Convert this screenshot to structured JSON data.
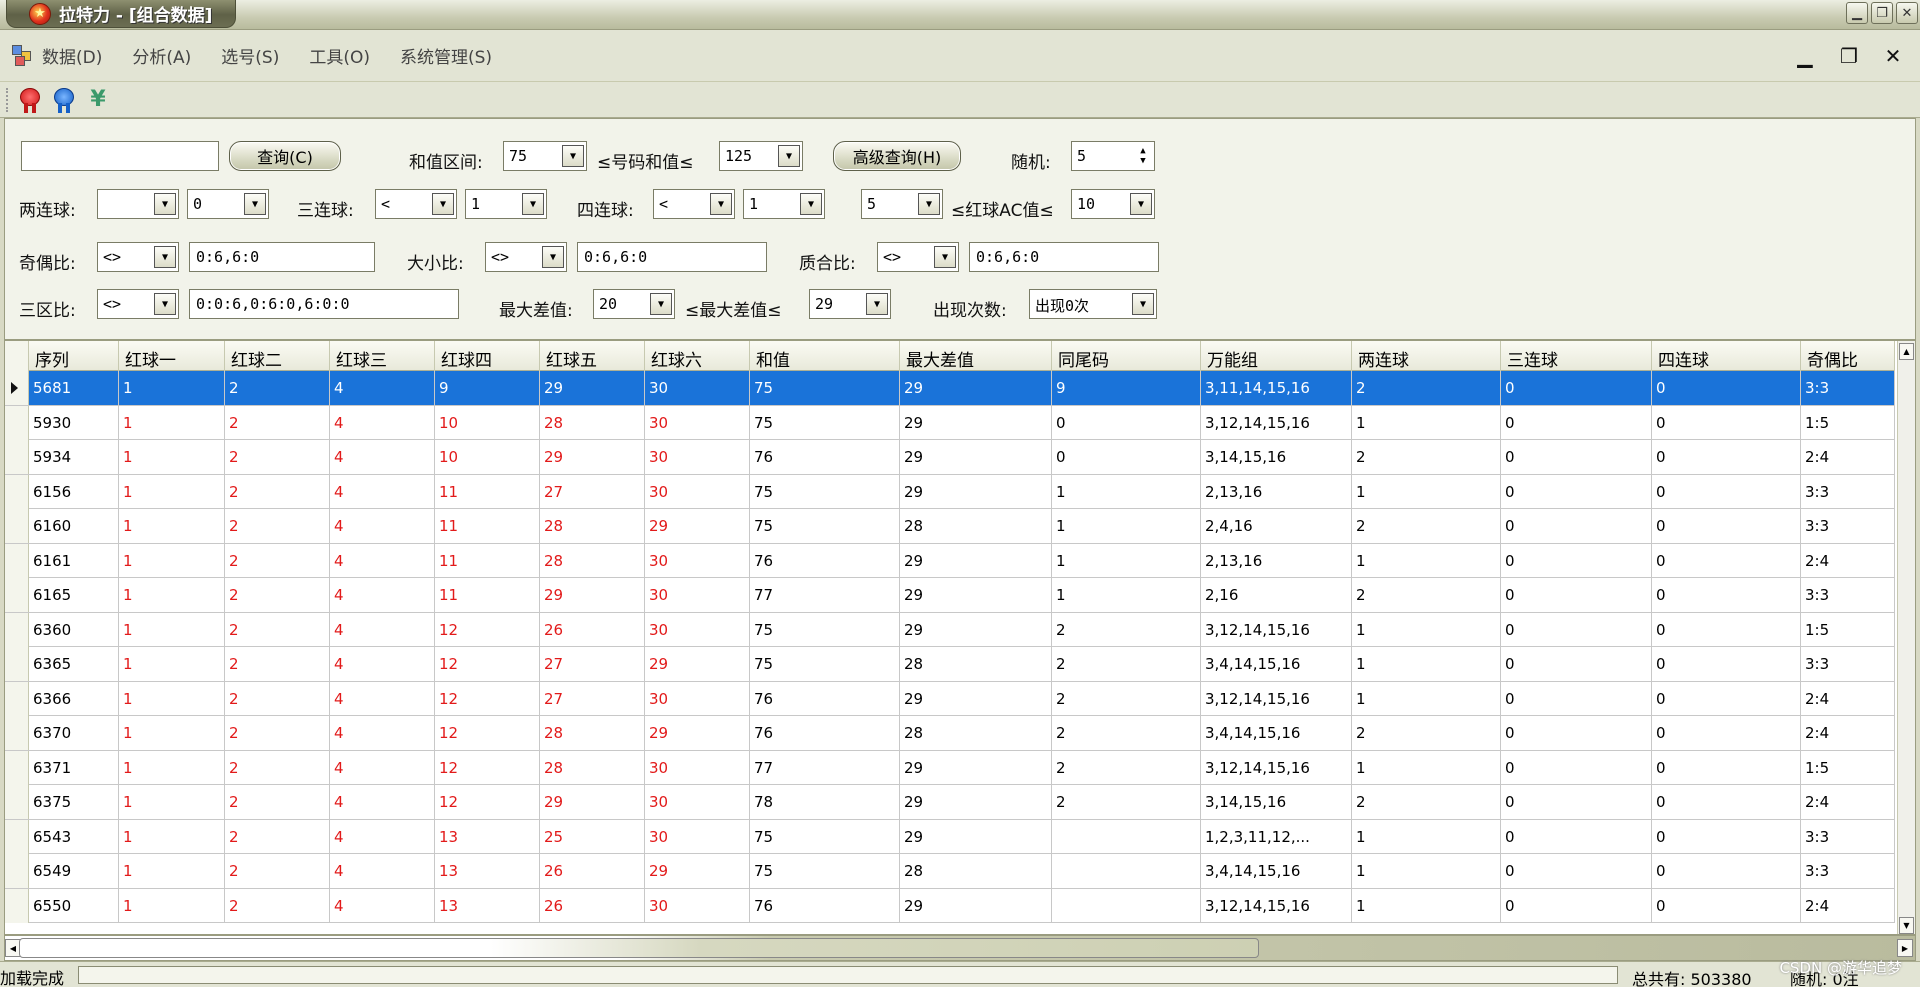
{
  "window": {
    "title": "拉特力 - [组合数据]",
    "controls": [
      "minimize",
      "restore",
      "close"
    ]
  },
  "menu": {
    "items": [
      "数据(D)",
      "分析(A)",
      "选号(S)",
      "工具(O)",
      "系统管理(S)"
    ]
  },
  "toolbar": {
    "icons": [
      "red-medal-icon",
      "blue-medal-icon",
      "yen-icon"
    ],
    "yen_glyph": "¥"
  },
  "query": {
    "search_value": "",
    "query_button": "查询(C)",
    "sum_range_label": "和值区间:",
    "sum_min": "75",
    "sum_mid_label": "≤号码和值≤",
    "sum_max": "125",
    "advanced_button": "高级查询(H)",
    "random_label": "随机:",
    "random_value": "5",
    "two_consec_label": "两连球:",
    "two_consec_op": "",
    "two_consec_val": "0",
    "three_consec_label": "三连球:",
    "three_consec_op": "<",
    "three_consec_val": "1",
    "four_consec_label": "四连球:",
    "four_consec_op": "<",
    "four_consec_val": "1",
    "ac_min": "5",
    "ac_label": "≤红球AC值≤",
    "ac_max": "10",
    "odd_even_label": "奇偶比:",
    "odd_even_op": "<>",
    "odd_even_val": "0:6,6:0",
    "big_small_label": "大小比:",
    "big_small_op": "<>",
    "big_small_val": "0:6,6:0",
    "prime_label": "质合比:",
    "prime_op": "<>",
    "prime_val": "0:6,6:0",
    "zone_label": "三区比:",
    "zone_op": "<>",
    "zone_val": "0:0:6,0:6:0,6:0:0",
    "max_diff_label": "最大差值:",
    "max_diff_min": "20",
    "max_diff_mid_label": "≤最大差值≤",
    "max_diff_max": "29",
    "occur_label": "出现次数:",
    "occur_val": "出现0次"
  },
  "grid": {
    "columns": [
      "序列",
      "红球一",
      "红球二",
      "红球三",
      "红球四",
      "红球五",
      "红球六",
      "和值",
      "最大差值",
      "同尾码",
      "万能组",
      "两连球",
      "三连球",
      "四连球",
      "奇偶比"
    ],
    "rows": [
      [
        "5681",
        "1",
        "2",
        "4",
        "9",
        "29",
        "30",
        "75",
        "29",
        "9",
        "3,11,14,15,16",
        "2",
        "0",
        "0",
        "3:3"
      ],
      [
        "5930",
        "1",
        "2",
        "4",
        "10",
        "28",
        "30",
        "75",
        "29",
        "0",
        "3,12,14,15,16",
        "1",
        "0",
        "0",
        "1:5"
      ],
      [
        "5934",
        "1",
        "2",
        "4",
        "10",
        "29",
        "30",
        "76",
        "29",
        "0",
        "3,14,15,16",
        "2",
        "0",
        "0",
        "2:4"
      ],
      [
        "6156",
        "1",
        "2",
        "4",
        "11",
        "27",
        "30",
        "75",
        "29",
        "1",
        "2,13,16",
        "1",
        "0",
        "0",
        "3:3"
      ],
      [
        "6160",
        "1",
        "2",
        "4",
        "11",
        "28",
        "29",
        "75",
        "28",
        "1",
        "2,4,16",
        "2",
        "0",
        "0",
        "3:3"
      ],
      [
        "6161",
        "1",
        "2",
        "4",
        "11",
        "28",
        "30",
        "76",
        "29",
        "1",
        "2,13,16",
        "1",
        "0",
        "0",
        "2:4"
      ],
      [
        "6165",
        "1",
        "2",
        "4",
        "11",
        "29",
        "30",
        "77",
        "29",
        "1",
        "2,16",
        "2",
        "0",
        "0",
        "3:3"
      ],
      [
        "6360",
        "1",
        "2",
        "4",
        "12",
        "26",
        "30",
        "75",
        "29",
        "2",
        "3,12,14,15,16",
        "1",
        "0",
        "0",
        "1:5"
      ],
      [
        "6365",
        "1",
        "2",
        "4",
        "12",
        "27",
        "29",
        "75",
        "28",
        "2",
        "3,4,14,15,16",
        "1",
        "0",
        "0",
        "3:3"
      ],
      [
        "6366",
        "1",
        "2",
        "4",
        "12",
        "27",
        "30",
        "76",
        "29",
        "2",
        "3,12,14,15,16",
        "1",
        "0",
        "0",
        "2:4"
      ],
      [
        "6370",
        "1",
        "2",
        "4",
        "12",
        "28",
        "29",
        "76",
        "28",
        "2",
        "3,4,14,15,16",
        "2",
        "0",
        "0",
        "2:4"
      ],
      [
        "6371",
        "1",
        "2",
        "4",
        "12",
        "28",
        "30",
        "77",
        "29",
        "2",
        "3,12,14,15,16",
        "1",
        "0",
        "0",
        "1:5"
      ],
      [
        "6375",
        "1",
        "2",
        "4",
        "12",
        "29",
        "30",
        "78",
        "29",
        "2",
        "3,14,15,16",
        "2",
        "0",
        "0",
        "2:4"
      ],
      [
        "6543",
        "1",
        "2",
        "4",
        "13",
        "25",
        "30",
        "75",
        "29",
        "",
        "1,2,3,11,12,...",
        "1",
        "0",
        "0",
        "3:3"
      ],
      [
        "6549",
        "1",
        "2",
        "4",
        "13",
        "26",
        "29",
        "75",
        "28",
        "",
        "3,4,14,15,16",
        "1",
        "0",
        "0",
        "3:3"
      ],
      [
        "6550",
        "1",
        "2",
        "4",
        "13",
        "26",
        "30",
        "76",
        "29",
        "",
        "3,12,14,15,16",
        "1",
        "0",
        "0",
        "2:4"
      ]
    ],
    "selected_row": 0,
    "red_columns": [
      1,
      2,
      3,
      4,
      5,
      6
    ]
  },
  "status": {
    "left": "加载完成",
    "total": "总共有: 503380",
    "random": "随机: 0注"
  },
  "watermark": "CSDN @游华追梦"
}
